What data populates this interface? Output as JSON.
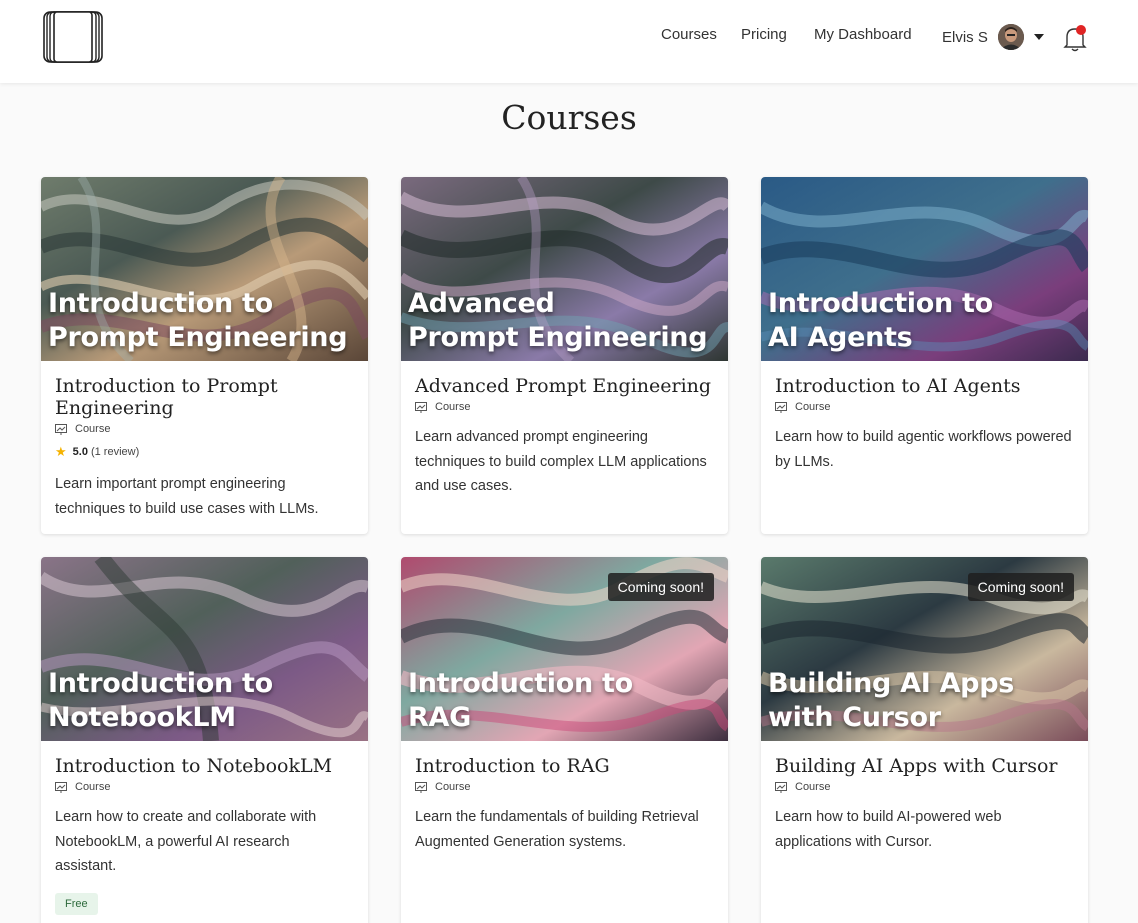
{
  "nav": {
    "courses": "Courses",
    "pricing": "Pricing",
    "dashboard": "My Dashboard",
    "user_name": "Elvis S"
  },
  "page": {
    "title": "Courses"
  },
  "cards": [
    {
      "image_title_l1": "Introduction to",
      "image_title_l2": "Prompt Engineering",
      "title": "Introduction to Prompt Engineering",
      "type": "Course",
      "rating": "5.0",
      "reviews": "(1 review)",
      "description": "Learn important prompt engineering techniques to build use cases with LLMs."
    },
    {
      "image_title_l1": "Advanced",
      "image_title_l2": "Prompt Engineering",
      "title": "Advanced Prompt Engineering",
      "type": "Course",
      "description": "Learn advanced prompt engineering techniques to build complex LLM applications and use cases."
    },
    {
      "image_title_l1": "Introduction to",
      "image_title_l2": "AI Agents",
      "title": "Introduction to AI Agents",
      "type": "Course",
      "description": "Learn how to build agentic workflows powered by LLMs."
    },
    {
      "image_title_l1": "Introduction to",
      "image_title_l2": "NotebookLM",
      "title": "Introduction to NotebookLM",
      "type": "Course",
      "description": "Learn how to create and collaborate with NotebookLM, a powerful AI research assistant.",
      "badge": "Free"
    },
    {
      "image_title_l1": "Introduction to",
      "image_title_l2": "RAG",
      "title": "Introduction to RAG",
      "type": "Course",
      "status": "Coming soon!",
      "description": "Learn the fundamentals of building Retrieval Augmented Generation systems."
    },
    {
      "image_title_l1": "Building AI Apps",
      "image_title_l2": "with Cursor",
      "title": "Building AI Apps with Cursor",
      "type": "Course",
      "status": "Coming soon!",
      "description": "Learn how to build AI-powered web applications with Cursor."
    }
  ],
  "colors": {
    "accent_notification": "#e02424",
    "free_badge_bg": "#e7f4ea",
    "star": "#f5b301"
  },
  "icons": [
    "logo-icon",
    "avatar",
    "chevron-down-icon",
    "bell-icon",
    "course-icon",
    "star-icon"
  ]
}
